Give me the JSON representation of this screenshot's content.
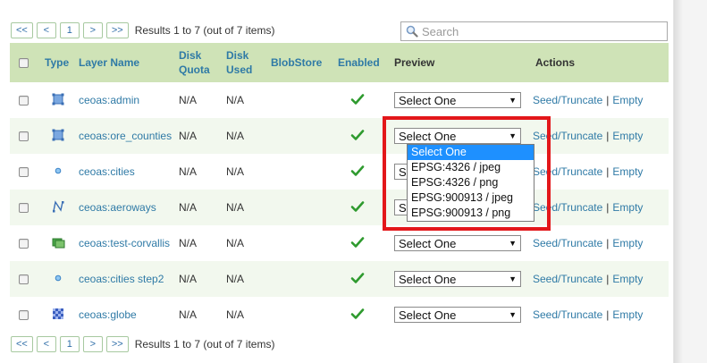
{
  "pager": {
    "first": "<<",
    "prev": "<",
    "page": "1",
    "next": ">",
    "last": ">>",
    "info": "Results 1 to 7 (out of 7 items)"
  },
  "search": {
    "placeholder": "Search"
  },
  "headers": {
    "type": "Type",
    "layer_name": "Layer Name",
    "disk_quota": "Disk Quota",
    "disk_used": "Disk Used",
    "blobstore": "BlobStore",
    "enabled": "Enabled",
    "preview": "Preview",
    "actions": "Actions"
  },
  "rows": [
    {
      "type_icon": "polygon-layer-icon",
      "name": "ceoas:admin",
      "disk_quota": "N/A",
      "disk_used": "N/A",
      "blobstore": "",
      "enabled": true,
      "preview": "Select One",
      "seed": "Seed/Truncate",
      "empty": "Empty"
    },
    {
      "type_icon": "polygon-layer-icon",
      "name": "ceoas:ore_counties",
      "disk_quota": "N/A",
      "disk_used": "N/A",
      "blobstore": "",
      "enabled": true,
      "preview": "Select One",
      "seed": "Seed/Truncate",
      "empty": "Empty"
    },
    {
      "type_icon": "point-layer-icon",
      "name": "ceoas:cities",
      "disk_quota": "N/A",
      "disk_used": "N/A",
      "blobstore": "",
      "enabled": true,
      "preview": "Select One",
      "seed": "Seed/Truncate",
      "empty": "Empty"
    },
    {
      "type_icon": "line-layer-icon",
      "name": "ceoas:aeroways",
      "disk_quota": "N/A",
      "disk_used": "N/A",
      "blobstore": "",
      "enabled": true,
      "preview": "Select One",
      "seed": "Seed/Truncate",
      "empty": "Empty"
    },
    {
      "type_icon": "layer-group-icon",
      "name": "ceoas:test-corvallis",
      "disk_quota": "N/A",
      "disk_used": "N/A",
      "blobstore": "",
      "enabled": true,
      "preview": "Select One",
      "seed": "Seed/Truncate",
      "empty": "Empty"
    },
    {
      "type_icon": "point-layer-icon",
      "name": "ceoas:cities step2",
      "disk_quota": "N/A",
      "disk_used": "N/A",
      "blobstore": "",
      "enabled": true,
      "preview": "Select One",
      "seed": "Seed/Truncate",
      "empty": "Empty"
    },
    {
      "type_icon": "raster-layer-icon",
      "name": "ceoas:globe",
      "disk_quota": "N/A",
      "disk_used": "N/A",
      "blobstore": "",
      "enabled": true,
      "preview": "Select One",
      "seed": "Seed/Truncate",
      "empty": "Empty"
    }
  ],
  "dropdown": {
    "options": [
      "Select One",
      "EPSG:4326 / jpeg",
      "EPSG:4326 / png",
      "EPSG:900913 / jpeg",
      "EPSG:900913 / png"
    ],
    "selected": "Select One"
  },
  "colors": {
    "header_bg": "#cfe3b7",
    "link": "#2f7aa6",
    "highlight": "#e3171a",
    "dropdown_selected": "#1e90ff",
    "enabled_check": "#2e9a2e"
  }
}
